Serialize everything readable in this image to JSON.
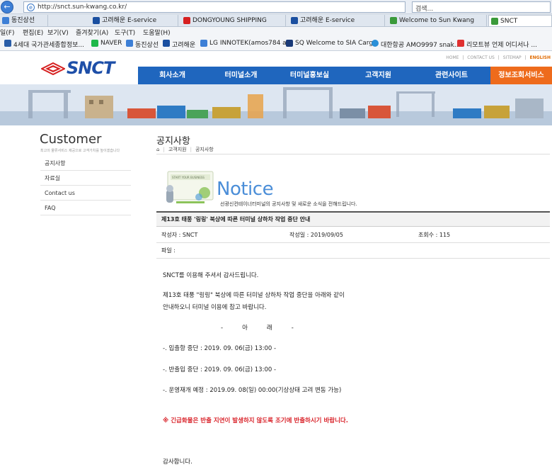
{
  "browser": {
    "address": "http://snct.sun-kwang.co.kr/",
    "search_placeholder": "검색...",
    "tabs": [
      {
        "label": "동진상선",
        "color": "#3d7fd6"
      },
      {
        "label": "고려해운 E-service",
        "color": "#1a4fa0"
      },
      {
        "label": "DONGYOUNG SHIPPING",
        "color": "#d62020"
      },
      {
        "label": "고려해운 E-service",
        "color": "#1a4fa0"
      },
      {
        "label": "Welcome to Sun Kwang",
        "color": "#3a9a3a"
      },
      {
        "label": "SNCT",
        "color": "#3a9a3a"
      }
    ],
    "menu": [
      "일(F)",
      "편집(E)",
      "보기(V)",
      "즐겨찾기(A)",
      "도구(T)",
      "도움말(H)"
    ],
    "favorites": [
      {
        "label": "4세대 국가관세종합정보...",
        "color": "#2a5ea8"
      },
      {
        "label": "NAVER",
        "color": "#1fb84a"
      },
      {
        "label": "동진상선",
        "color": "#3d7fd6"
      },
      {
        "label": "고려해운",
        "color": "#1a4fa0"
      },
      {
        "label": "LG INNOTEK(amos784 a...",
        "color": "#3d7fd6"
      },
      {
        "label": "SQ Welcome to SIA Cargo",
        "color": "#1a3a78"
      },
      {
        "label": "대한항공 AMO9997 snak...",
        "color": "#2a8fd8"
      },
      {
        "label": "리모트뷰  언제 어디서나 ...",
        "color": "#e03030"
      }
    ]
  },
  "site": {
    "top_links": [
      "HOME",
      "CONTACT US",
      "SITEMAP",
      "ENGLISH"
    ],
    "logo": "SNCT",
    "nav": [
      "회사소개",
      "터미널소개",
      "터미널홍보실",
      "고객지원",
      "관련사이트",
      "정보조회서비스"
    ],
    "sidebar": {
      "title": "Customer",
      "subtitle": "최고의 물류서비스 제공으로 고객가치를 높이겠습니다",
      "items": [
        "공지사항",
        "자료실",
        "Contact us",
        "FAQ"
      ]
    },
    "page_title": "공지사항",
    "breadcrumb": [
      "⌂",
      "고객지원",
      "공지사항"
    ],
    "notice": {
      "word": "Notice",
      "desc": "선광신컨테이너터미널의 공지사항 및 새로운 소식을 전해드립니다.",
      "art_caption": "START YOUR BUSINESS"
    },
    "post": {
      "subject": "제13호 태풍 '링링' 북상에 따른 터미널 상하차 작업 중단 안내",
      "author_label": "작성자 : SNCT",
      "date_label": "작성일 : 2019/09/05",
      "views_label": "조회수 : 115",
      "file_label": "파일 :",
      "body": [
        "SNCT를 이용해 주셔서 감사드립니다.",
        "제13호 태풍 \"링링\" 북상에 따른 터미널 상하차 작업 중단을 아래와 같이",
        "안내하오니 터미널 이용에 참고 바랍니다.",
        "-          아          래          -",
        "-. 입출항 중단 : 2019. 09. 06(금) 13:00 -",
        "-. 반출입 중단 : 2019. 09. 06(금) 13:00 -",
        "-. 운영재개 예정 : 2019.09. 08(일) 00:00(기상상태 고려 변동 가능)",
        "※ 긴급화물은 반출 지연이 발생하지 않도록 조기에 반출하시기 바랍니다.",
        "감사합니다."
      ]
    }
  }
}
